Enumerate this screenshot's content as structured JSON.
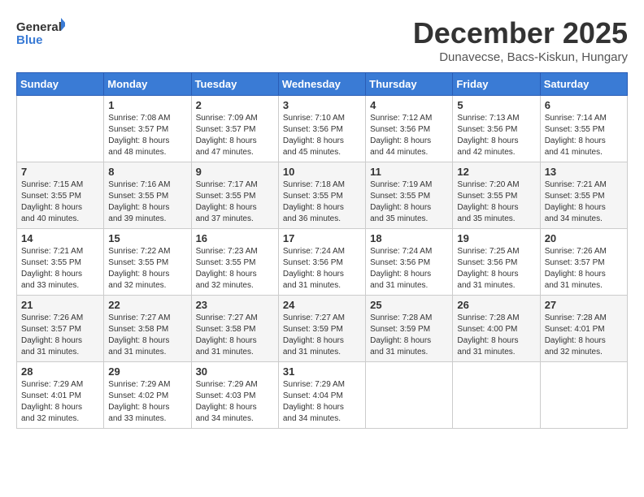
{
  "logo": {
    "text_general": "General",
    "text_blue": "Blue"
  },
  "header": {
    "month": "December 2025",
    "location": "Dunavecse, Bacs-Kiskun, Hungary"
  },
  "weekdays": [
    "Sunday",
    "Monday",
    "Tuesday",
    "Wednesday",
    "Thursday",
    "Friday",
    "Saturday"
  ],
  "weeks": [
    [
      {
        "day": "",
        "info": ""
      },
      {
        "day": "1",
        "info": "Sunrise: 7:08 AM\nSunset: 3:57 PM\nDaylight: 8 hours\nand 48 minutes."
      },
      {
        "day": "2",
        "info": "Sunrise: 7:09 AM\nSunset: 3:57 PM\nDaylight: 8 hours\nand 47 minutes."
      },
      {
        "day": "3",
        "info": "Sunrise: 7:10 AM\nSunset: 3:56 PM\nDaylight: 8 hours\nand 45 minutes."
      },
      {
        "day": "4",
        "info": "Sunrise: 7:12 AM\nSunset: 3:56 PM\nDaylight: 8 hours\nand 44 minutes."
      },
      {
        "day": "5",
        "info": "Sunrise: 7:13 AM\nSunset: 3:56 PM\nDaylight: 8 hours\nand 42 minutes."
      },
      {
        "day": "6",
        "info": "Sunrise: 7:14 AM\nSunset: 3:55 PM\nDaylight: 8 hours\nand 41 minutes."
      }
    ],
    [
      {
        "day": "7",
        "info": "Sunrise: 7:15 AM\nSunset: 3:55 PM\nDaylight: 8 hours\nand 40 minutes."
      },
      {
        "day": "8",
        "info": "Sunrise: 7:16 AM\nSunset: 3:55 PM\nDaylight: 8 hours\nand 39 minutes."
      },
      {
        "day": "9",
        "info": "Sunrise: 7:17 AM\nSunset: 3:55 PM\nDaylight: 8 hours\nand 37 minutes."
      },
      {
        "day": "10",
        "info": "Sunrise: 7:18 AM\nSunset: 3:55 PM\nDaylight: 8 hours\nand 36 minutes."
      },
      {
        "day": "11",
        "info": "Sunrise: 7:19 AM\nSunset: 3:55 PM\nDaylight: 8 hours\nand 35 minutes."
      },
      {
        "day": "12",
        "info": "Sunrise: 7:20 AM\nSunset: 3:55 PM\nDaylight: 8 hours\nand 35 minutes."
      },
      {
        "day": "13",
        "info": "Sunrise: 7:21 AM\nSunset: 3:55 PM\nDaylight: 8 hours\nand 34 minutes."
      }
    ],
    [
      {
        "day": "14",
        "info": "Sunrise: 7:21 AM\nSunset: 3:55 PM\nDaylight: 8 hours\nand 33 minutes."
      },
      {
        "day": "15",
        "info": "Sunrise: 7:22 AM\nSunset: 3:55 PM\nDaylight: 8 hours\nand 32 minutes."
      },
      {
        "day": "16",
        "info": "Sunrise: 7:23 AM\nSunset: 3:55 PM\nDaylight: 8 hours\nand 32 minutes."
      },
      {
        "day": "17",
        "info": "Sunrise: 7:24 AM\nSunset: 3:56 PM\nDaylight: 8 hours\nand 31 minutes."
      },
      {
        "day": "18",
        "info": "Sunrise: 7:24 AM\nSunset: 3:56 PM\nDaylight: 8 hours\nand 31 minutes."
      },
      {
        "day": "19",
        "info": "Sunrise: 7:25 AM\nSunset: 3:56 PM\nDaylight: 8 hours\nand 31 minutes."
      },
      {
        "day": "20",
        "info": "Sunrise: 7:26 AM\nSunset: 3:57 PM\nDaylight: 8 hours\nand 31 minutes."
      }
    ],
    [
      {
        "day": "21",
        "info": "Sunrise: 7:26 AM\nSunset: 3:57 PM\nDaylight: 8 hours\nand 31 minutes."
      },
      {
        "day": "22",
        "info": "Sunrise: 7:27 AM\nSunset: 3:58 PM\nDaylight: 8 hours\nand 31 minutes."
      },
      {
        "day": "23",
        "info": "Sunrise: 7:27 AM\nSunset: 3:58 PM\nDaylight: 8 hours\nand 31 minutes."
      },
      {
        "day": "24",
        "info": "Sunrise: 7:27 AM\nSunset: 3:59 PM\nDaylight: 8 hours\nand 31 minutes."
      },
      {
        "day": "25",
        "info": "Sunrise: 7:28 AM\nSunset: 3:59 PM\nDaylight: 8 hours\nand 31 minutes."
      },
      {
        "day": "26",
        "info": "Sunrise: 7:28 AM\nSunset: 4:00 PM\nDaylight: 8 hours\nand 31 minutes."
      },
      {
        "day": "27",
        "info": "Sunrise: 7:28 AM\nSunset: 4:01 PM\nDaylight: 8 hours\nand 32 minutes."
      }
    ],
    [
      {
        "day": "28",
        "info": "Sunrise: 7:29 AM\nSunset: 4:01 PM\nDaylight: 8 hours\nand 32 minutes."
      },
      {
        "day": "29",
        "info": "Sunrise: 7:29 AM\nSunset: 4:02 PM\nDaylight: 8 hours\nand 33 minutes."
      },
      {
        "day": "30",
        "info": "Sunrise: 7:29 AM\nSunset: 4:03 PM\nDaylight: 8 hours\nand 34 minutes."
      },
      {
        "day": "31",
        "info": "Sunrise: 7:29 AM\nSunset: 4:04 PM\nDaylight: 8 hours\nand 34 minutes."
      },
      {
        "day": "",
        "info": ""
      },
      {
        "day": "",
        "info": ""
      },
      {
        "day": "",
        "info": ""
      }
    ]
  ]
}
